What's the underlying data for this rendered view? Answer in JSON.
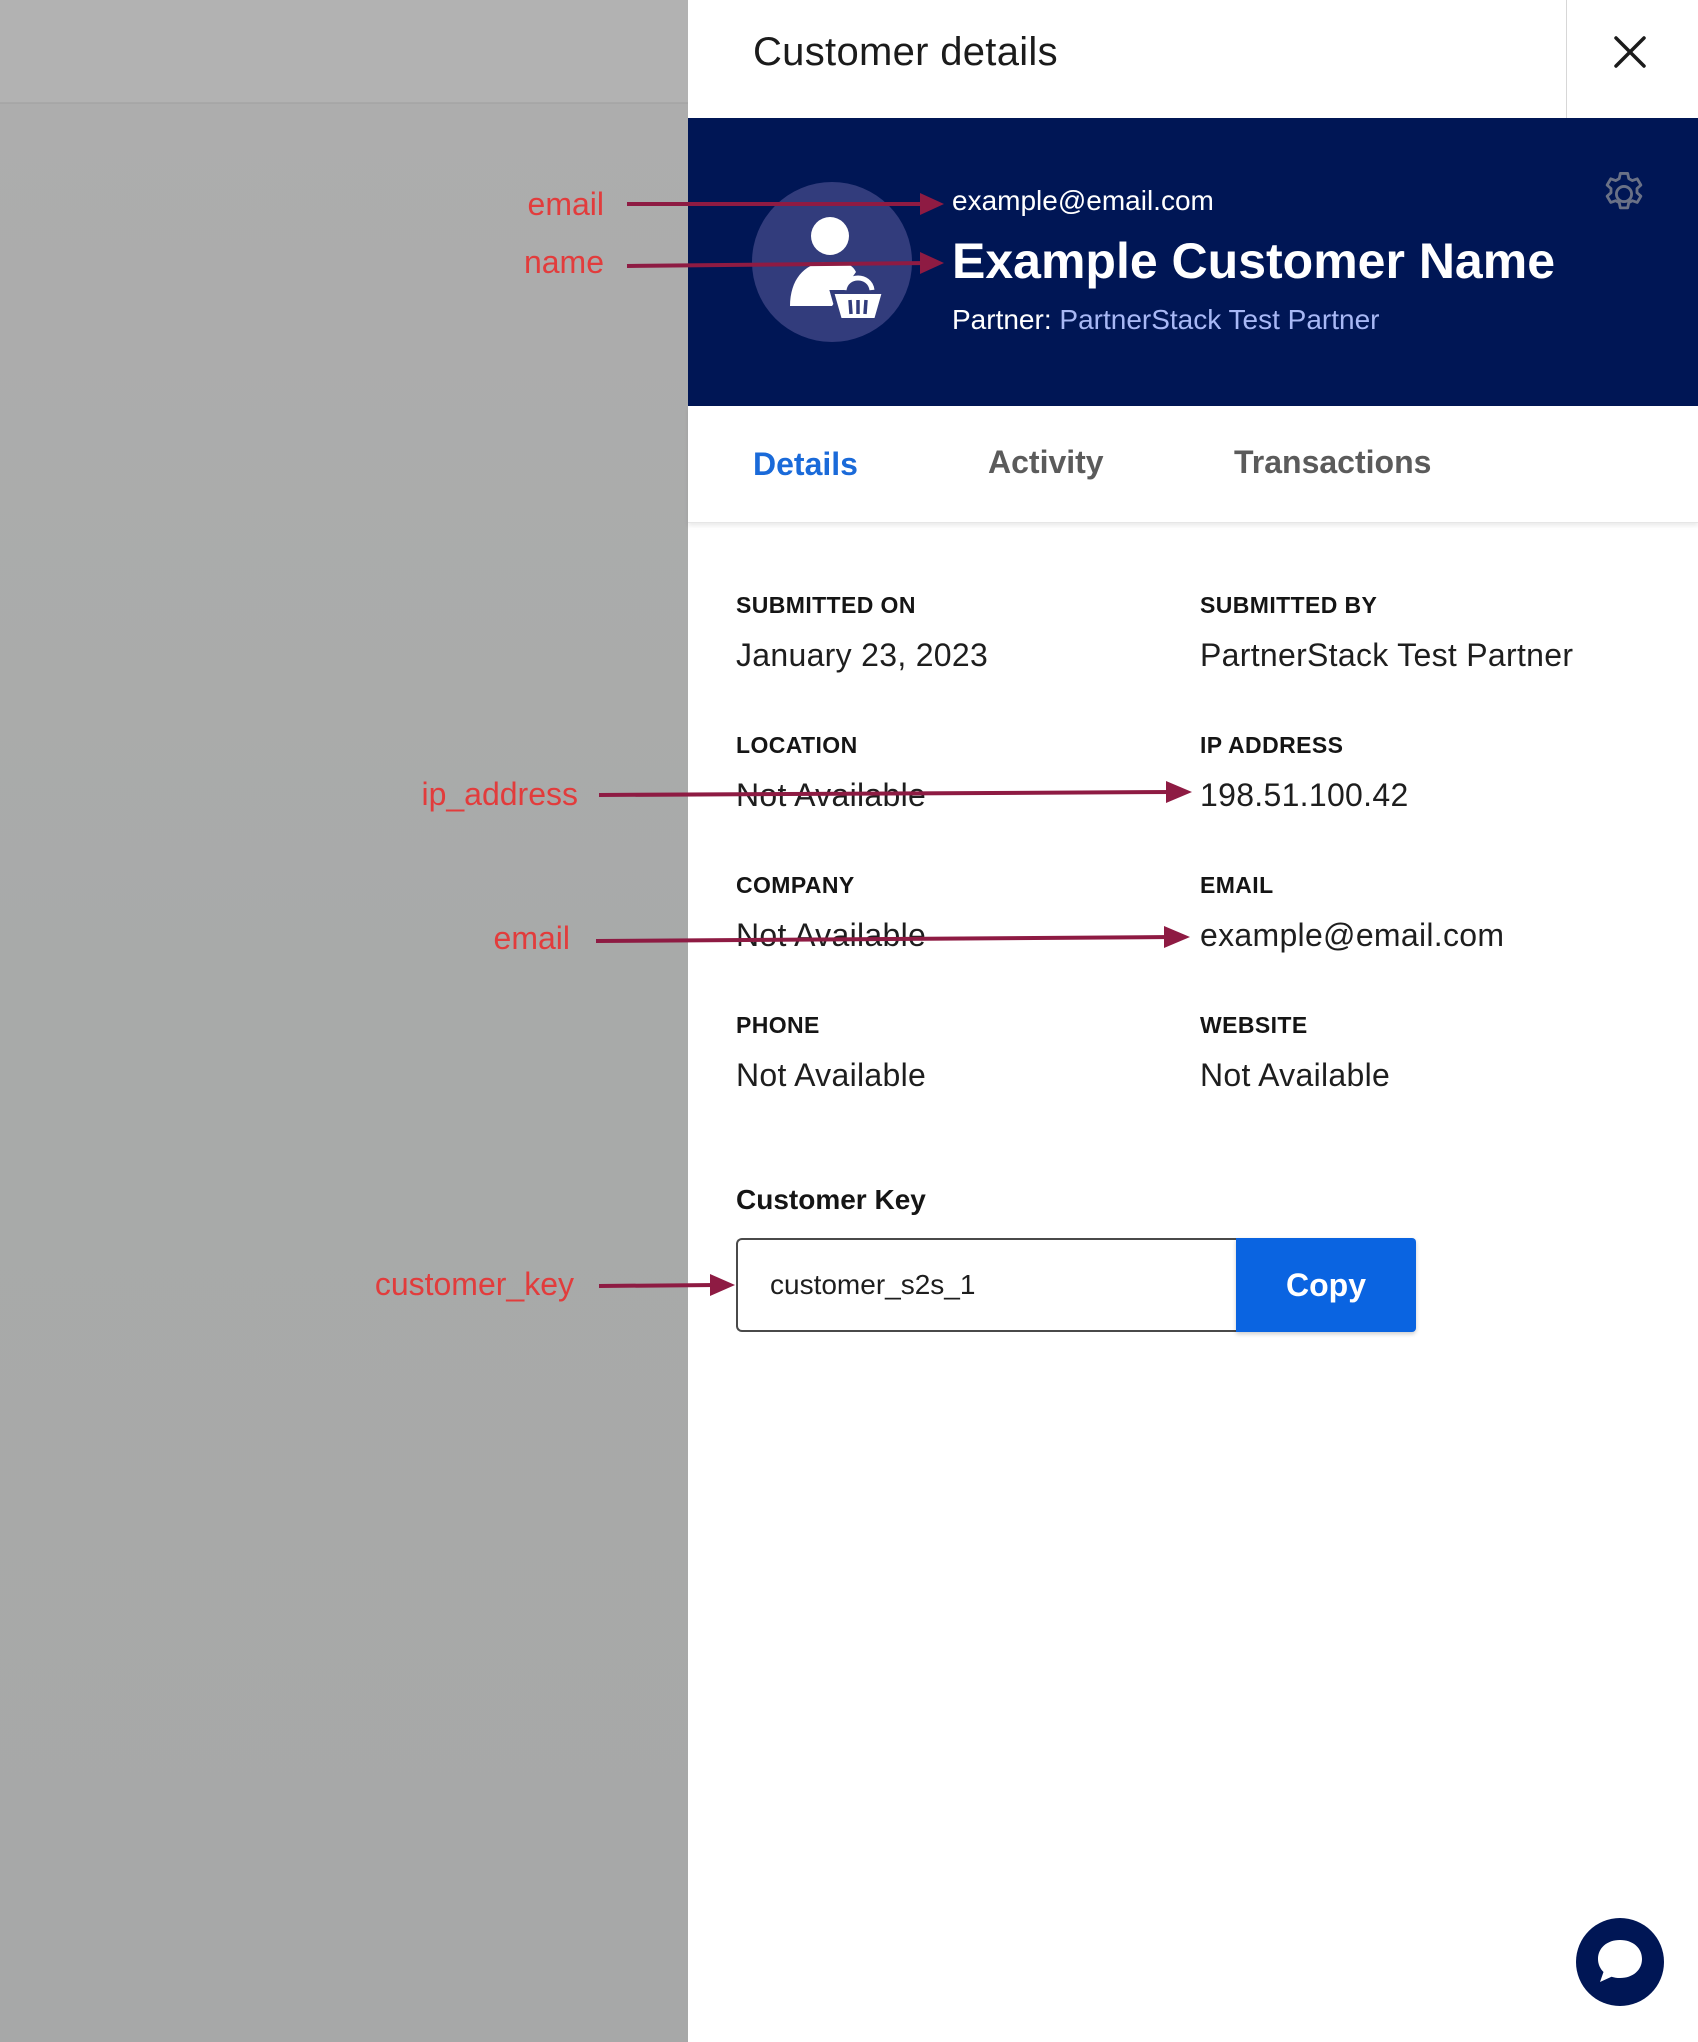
{
  "panel": {
    "title": "Customer details"
  },
  "hero": {
    "email": "example@email.com",
    "name": "Example Customer Name",
    "partner_label": "Partner:",
    "partner_name": "PartnerStack Test Partner"
  },
  "tabs": [
    {
      "label": "Details",
      "active": true
    },
    {
      "label": "Activity",
      "active": false
    },
    {
      "label": "Transactions",
      "active": false
    }
  ],
  "fields": {
    "submitted_on": {
      "label": "SUBMITTED ON",
      "value": "January 23, 2023"
    },
    "submitted_by": {
      "label": "SUBMITTED BY",
      "value": "PartnerStack Test Partner"
    },
    "location": {
      "label": "LOCATION",
      "value": "Not Available"
    },
    "ip_address": {
      "label": "IP ADDRESS",
      "value": "198.51.100.42"
    },
    "company": {
      "label": "COMPANY",
      "value": "Not Available"
    },
    "email": {
      "label": "EMAIL",
      "value": "example@email.com"
    },
    "phone": {
      "label": "PHONE",
      "value": "Not Available"
    },
    "website": {
      "label": "WEBSITE",
      "value": "Not Available"
    }
  },
  "customer_key": {
    "label": "Customer Key",
    "value": "customer_s2s_1",
    "copy_label": "Copy"
  },
  "annotations": {
    "email_top": "email",
    "name": "name",
    "ip_address": "ip_address",
    "email_field": "email",
    "customer_key": "customer_key"
  },
  "icons": {
    "close": "close-icon",
    "gear": "gear-icon",
    "avatar": "customer-basket-icon",
    "chat": "chat-bubble-icon"
  },
  "colors": {
    "hero_bg": "#001655",
    "accent": "#1a6ad9",
    "copy_button": "#0a64e1",
    "annotation": "#e23c3c",
    "arrow": "#8e1b43",
    "partner_link": "#a8b8f5"
  }
}
